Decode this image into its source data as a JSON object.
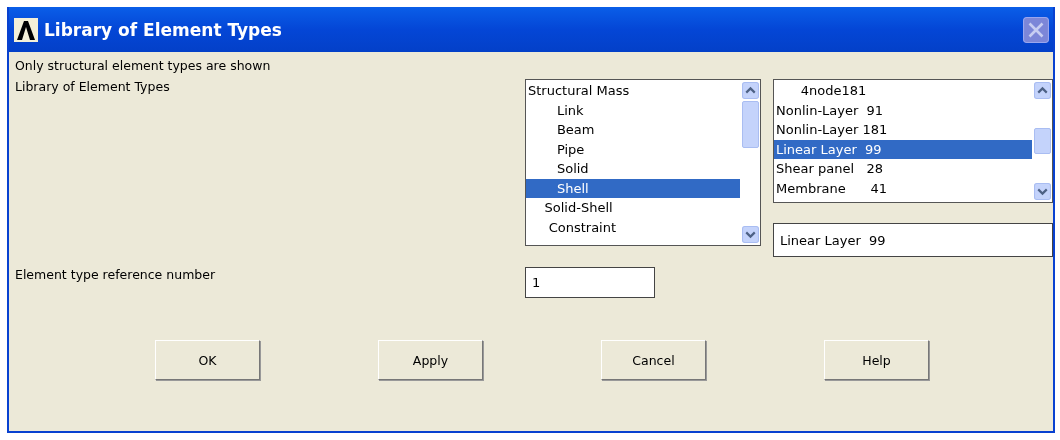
{
  "window": {
    "title": "Library of Element Types"
  },
  "note": "Only structural element types are shown",
  "library_label": "Library of Element Types",
  "category_list": [
    {
      "label": "Structural Mass",
      "selected": false
    },
    {
      "label": "       Link",
      "selected": false
    },
    {
      "label": "       Beam",
      "selected": false
    },
    {
      "label": "       Pipe",
      "selected": false
    },
    {
      "label": "       Solid",
      "selected": false
    },
    {
      "label": "       Shell",
      "selected": true
    },
    {
      "label": "    Solid-Shell",
      "selected": false
    },
    {
      "label": "     Constraint",
      "selected": false
    }
  ],
  "type_list": [
    {
      "label": "      4node181",
      "selected": false
    },
    {
      "label": "Nonlin-Layer  91",
      "selected": false
    },
    {
      "label": "Nonlin-Layer 181",
      "selected": false
    },
    {
      "label": "Linear Layer  99",
      "selected": true
    },
    {
      "label": "Shear panel   28",
      "selected": false
    },
    {
      "label": "Membrane      41",
      "selected": false
    }
  ],
  "selection_field": {
    "value": "Linear Layer  99"
  },
  "reference_label": "Element type reference number",
  "reference_field": {
    "value": "1"
  },
  "buttons": [
    "OK",
    "Apply",
    "Cancel",
    "Help"
  ]
}
